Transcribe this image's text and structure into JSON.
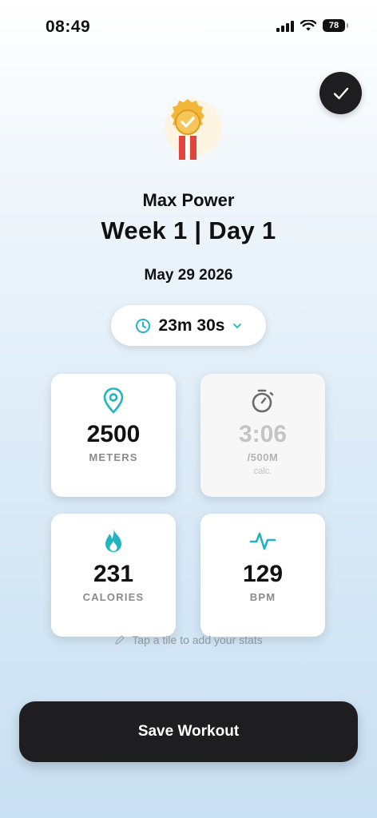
{
  "status_bar": {
    "time": "08:49",
    "battery": "78",
    "icons": [
      "signal-icon",
      "wifi-icon",
      "battery-icon"
    ]
  },
  "header": {
    "done_icon": "checkmark-icon",
    "badge_icon": "award-ribbon-icon",
    "program": "Max Power",
    "session": "Week 1 | Day 1",
    "date": "May 29 2026"
  },
  "duration": {
    "icon": "clock-icon",
    "value": "23m 30s",
    "chevron": "chevron-down-icon"
  },
  "tiles": [
    {
      "icon": "location-pin-icon",
      "value": "2500",
      "label": "METERS",
      "note": ""
    },
    {
      "icon": "stopwatch-icon",
      "value": "3:06",
      "label": "/500M",
      "note": "calc."
    },
    {
      "icon": "flame-icon",
      "value": "231",
      "label": "CALORIES",
      "note": ""
    },
    {
      "icon": "heartbeat-icon",
      "value": "129",
      "label": "BPM",
      "note": ""
    }
  ],
  "hint": {
    "icon": "pencil-icon",
    "text": "Tap a tile to add your stats"
  },
  "save_button": {
    "label": "Save Workout"
  },
  "colors": {
    "accent": "#1fb5c1",
    "dark": "#1e1e20",
    "gold": "#f2b63a",
    "ribbon": "#e0453b"
  }
}
